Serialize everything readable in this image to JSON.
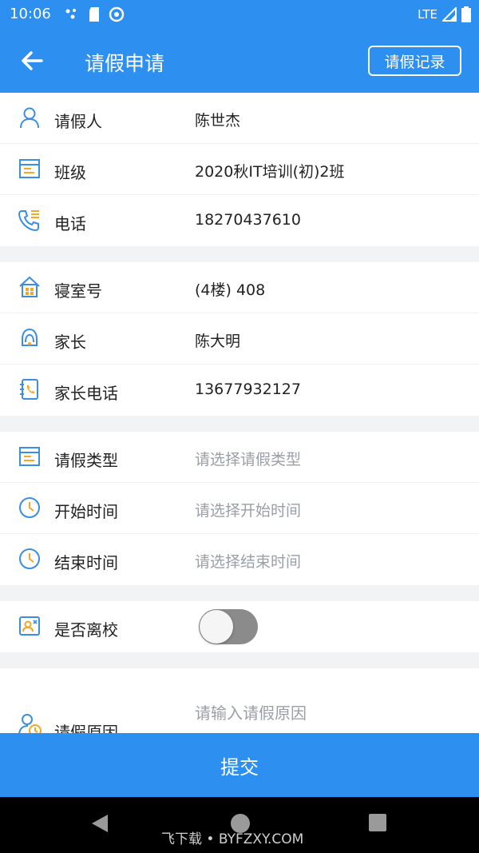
{
  "status_bar": {
    "time": "10:06",
    "network": "LTE"
  },
  "app_bar": {
    "title": "请假申请",
    "record_button": "请假记录"
  },
  "info_group_1": [
    {
      "label": "请假人",
      "value": "陈世杰",
      "icon": "person-icon"
    },
    {
      "label": "班级",
      "value": "2020秋IT培训(初)2班",
      "icon": "class-board-icon"
    },
    {
      "label": "电话",
      "value": "18270437610",
      "icon": "phone-icon"
    }
  ],
  "info_group_2": [
    {
      "label": "寝室号",
      "value": "(4楼) 408",
      "icon": "dorm-house-icon"
    },
    {
      "label": "家长",
      "value": "陈大明",
      "icon": "parent-icon"
    },
    {
      "label": "家长电话",
      "value": "13677932127",
      "icon": "contact-book-icon"
    }
  ],
  "leave_group": [
    {
      "label": "请假类型",
      "placeholder": "请选择请假类型",
      "icon": "type-board-icon"
    },
    {
      "label": "开始时间",
      "placeholder": "请选择开始时间",
      "icon": "clock-icon"
    },
    {
      "label": "结束时间",
      "placeholder": "请选择结束时间",
      "icon": "clock-icon"
    }
  ],
  "leave_school": {
    "label": "是否离校",
    "toggle_on": false,
    "icon": "leave-school-icon"
  },
  "reason": {
    "label": "请假原因",
    "placeholder": "请输入请假原因",
    "icon": "user-clock-icon"
  },
  "submit_label": "提交",
  "watermark": "飞下载 • BYFZXY.COM",
  "colors": {
    "primary": "#2d8ff0",
    "icon_blue": "#3a8ee6",
    "icon_orange": "#f5a623"
  }
}
